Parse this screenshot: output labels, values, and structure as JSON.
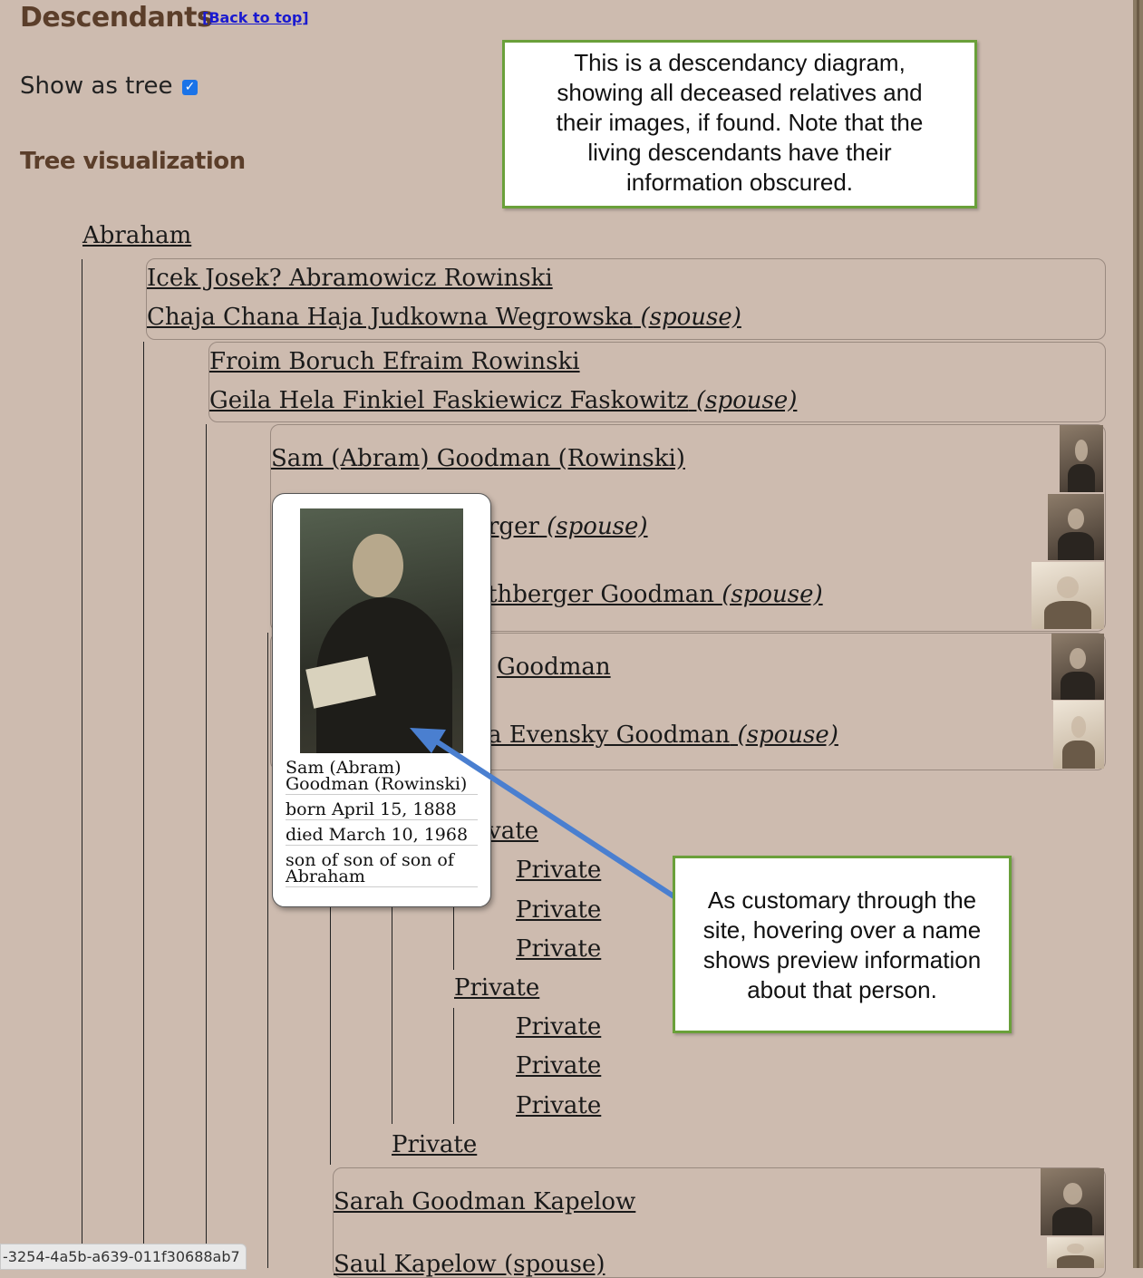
{
  "header": {
    "title": "Descendants",
    "back_to_top": "[Back to top]",
    "show_as_tree": "Show as tree",
    "show_as_tree_checked": true,
    "subtitle": "Tree visualization"
  },
  "callouts": {
    "top": [
      "This is a descendancy diagram,",
      "showing all deceased relatives and",
      "their images, if found.  Note that the",
      "living descendants have their",
      "information obscured."
    ],
    "bottom": [
      "As customary through the",
      "site, hovering over a name",
      "shows preview information",
      "about that person."
    ],
    "border_color": "#6aa03a",
    "arrow_color": "#4a7fd0"
  },
  "tree": {
    "root": "Abraham",
    "gen1": {
      "person": "Icek Josek? Abramowicz Rowinski",
      "spouse": "Chaja Chana Haja Judkowna Wegrowska",
      "spouse_suffix": "(spouse)"
    },
    "gen2": {
      "person": "Froim Boruch Efraim Rowinski",
      "spouse": "Geila Hela Finkiel Faskiewicz Faskowitz",
      "spouse_suffix": "(spouse)"
    },
    "gen3": {
      "person": "Sam (Abram) Goodman (Rowinski)",
      "spouse1_visible": "rger",
      "spouse2_visible": "thberger Goodman",
      "spouse_suffix": "(spouse)"
    },
    "gen4_a": {
      "person_visible": "Goodman",
      "spouse_visible": "a Evensky Goodman",
      "spouse_suffix": "(spouse)"
    },
    "private_label": "Private",
    "private_partial": "vate",
    "sarah": "Sarah Goodman Kapelow",
    "saul_partial": "Saul Kapelow (spouse)"
  },
  "popup": {
    "name": "Sam (Abram) Goodman (Rowinski)",
    "born": "born April 15, 1888",
    "died": "died March 10, 1968",
    "relation": "son of son of son of Abraham"
  },
  "statusbar": "-3254-4a5b-a639-011f30688ab7"
}
